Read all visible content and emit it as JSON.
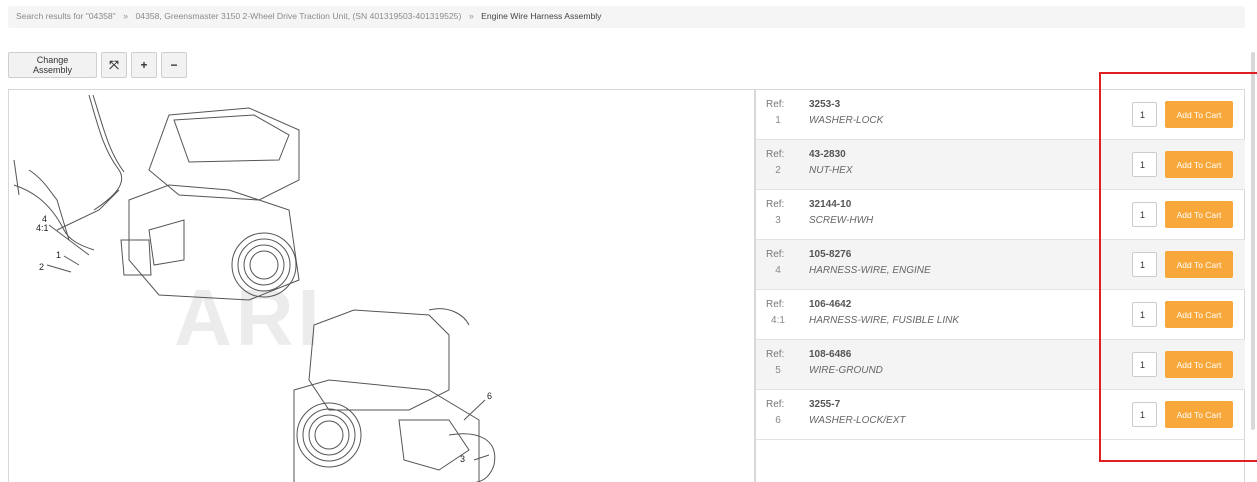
{
  "breadcrumb": {
    "items": [
      "Search results for \"04358\"",
      "04358, Greensmaster 3150 2-Wheel Drive Traction Unit, (SN 401319503-401319525)",
      "Engine Wire Harness Assembly"
    ],
    "separator": "»"
  },
  "toolbar": {
    "change_assembly": "Change Assembly",
    "expand_icon": "⤧",
    "zoom_in": "+",
    "zoom_out": "−"
  },
  "diagram": {
    "watermark": "ARI",
    "callouts": [
      "4",
      "4:1",
      "1",
      "2",
      "6",
      "3"
    ]
  },
  "parts": {
    "ref_label": "Ref:",
    "add_to_cart_label": "Add To Cart",
    "rows": [
      {
        "ref": "1",
        "part_no": "3253-3",
        "desc": "WASHER-LOCK",
        "qty": "1"
      },
      {
        "ref": "2",
        "part_no": "43-2830",
        "desc": "NUT-HEX",
        "qty": "1"
      },
      {
        "ref": "3",
        "part_no": "32144-10",
        "desc": "SCREW-HWH",
        "qty": "1"
      },
      {
        "ref": "4",
        "part_no": "105-8276",
        "desc": "HARNESS-WIRE, ENGINE",
        "qty": "1"
      },
      {
        "ref": "4:1",
        "part_no": "106-4642",
        "desc": "HARNESS-WIRE, FUSIBLE LINK",
        "qty": "1"
      },
      {
        "ref": "5",
        "part_no": "108-6486",
        "desc": "WIRE-GROUND",
        "qty": "1"
      },
      {
        "ref": "6",
        "part_no": "3255-7",
        "desc": "WASHER-LOCK/EXT",
        "qty": "1"
      }
    ]
  },
  "colors": {
    "accent": "#f8a73a",
    "highlight": "#e02020"
  }
}
